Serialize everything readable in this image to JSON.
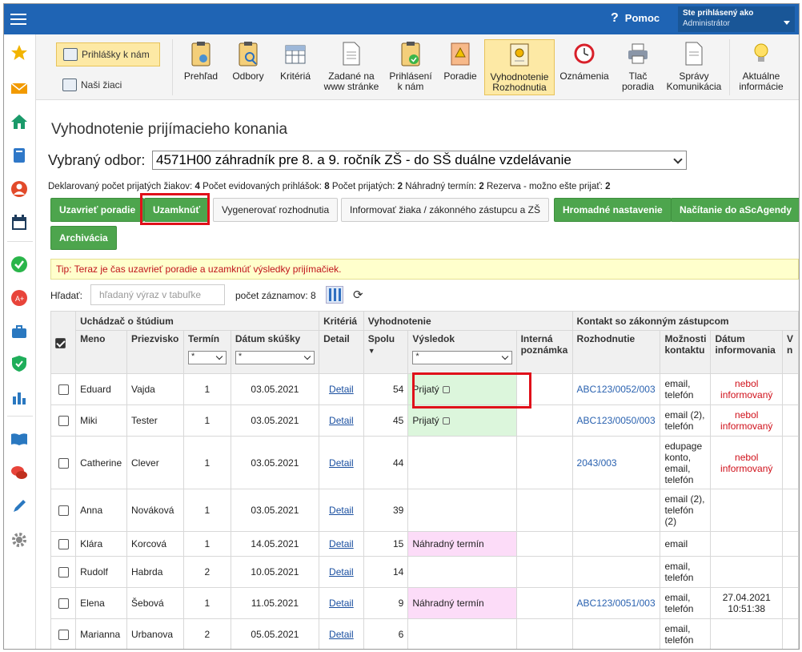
{
  "header": {
    "help_label": "Pomoc",
    "help_icon": "?",
    "user_line1": "Ste prihlásený ako",
    "user_line2": "Administrátor"
  },
  "toolbar": {
    "left_buttons": [
      "Prihlášky k nám",
      "Naši žiaci"
    ],
    "tools": [
      {
        "label1": "Prehľad",
        "label2": ""
      },
      {
        "label1": "Odbory",
        "label2": ""
      },
      {
        "label1": "Kritériá",
        "label2": ""
      },
      {
        "label1": "Zadané na",
        "label2": "www stránke"
      },
      {
        "label1": "Prihlásení",
        "label2": "k nám"
      },
      {
        "label1": "Poradie",
        "label2": ""
      },
      {
        "label1": "Vyhodnotenie",
        "label2": "Rozhodnutia"
      },
      {
        "label1": "Oznámenia",
        "label2": ""
      },
      {
        "label1": "Tlač",
        "label2": "poradia"
      },
      {
        "label1": "Správy",
        "label2": "Komunikácia"
      },
      {
        "label1": "Aktuálne",
        "label2": "informácie"
      }
    ]
  },
  "page": {
    "title": "Vyhodnotenie prijímacieho konania",
    "odbor_label": "Vybraný odbor:",
    "odbor_value": "4571H00 záhradník pre 8. a 9. ročník ZŠ - do SŠ duálne vzdelávanie"
  },
  "stats": {
    "l1": "Deklarovaný počet prijatých žiakov:",
    "v1": "4",
    "l2": "Počet evidovaných prihlášok:",
    "v2": "8",
    "l3": "Počet prijatých:",
    "v3": "2",
    "l4": "Náhradný termín:",
    "v4": "2",
    "l5": "Rezerva - možno ešte prijať:",
    "v5": "2"
  },
  "actions": {
    "close_order": "Uzavrieť poradie",
    "lock": "Uzamknúť",
    "generate": "Vygenerovať rozhodnutia",
    "inform": "Informovať žiaka / zákonného zástupcu a ZŠ",
    "bulk": "Hromadné nastavenie",
    "load": "Načítanie do aScAgendy",
    "archive": "Archivácia"
  },
  "tip": "Tip: Teraz je čas uzavrieť poradie a uzamknúť výsledky prijímačiek.",
  "search": {
    "label": "Hľadať:",
    "placeholder": "hľadaný výraz v tabuľke",
    "count_label": "počet záznamov: 8"
  },
  "table": {
    "groups": {
      "applicant": "Uchádzač o štúdium",
      "criteria": "Kritériá",
      "evaluation": "Vyhodnotenie",
      "contact": "Kontakt so zákonným zástupcom"
    },
    "columns": {
      "name": "Meno",
      "surname": "Priezvisko",
      "term": "Termín",
      "exam_date": "Dátum skúšky",
      "detail": "Detail",
      "total": "Spolu",
      "result": "Výsledok",
      "note1": "Interná",
      "note2": "poznámka",
      "decision": "Rozhodnutie",
      "contact_opts1": "Možnosti",
      "contact_opts2": "kontaktu",
      "inform_date1": "Dátum",
      "inform_date2": "informovania",
      "extra1": "V",
      "extra2": "n"
    },
    "filter_value": "*",
    "detail_link": "Detail",
    "rows": [
      {
        "meno": "Eduard",
        "priezvisko": "Vajda",
        "termin": "1",
        "datum": "03.05.2021",
        "spolu": "54",
        "vysledok": "Prijatý",
        "typ": "prij",
        "rozhodnutie": "ABC123/0052/003",
        "kontakt": [
          "email,",
          "telefón"
        ],
        "inf": [
          "nebol",
          "informovaný"
        ],
        "infred": true
      },
      {
        "meno": "Miki",
        "priezvisko": "Tester",
        "termin": "1",
        "datum": "03.05.2021",
        "spolu": "45",
        "vysledok": "Prijatý",
        "typ": "prij",
        "rozhodnutie": "ABC123/0050/003",
        "kontakt": [
          "email (2),",
          "telefón"
        ],
        "inf": [
          "nebol",
          "informovaný"
        ],
        "infred": true
      },
      {
        "meno": "Catherine",
        "priezvisko": "Clever",
        "termin": "1",
        "datum": "03.05.2021",
        "spolu": "44",
        "vysledok": "",
        "typ": "",
        "rozhodnutie": "2043/003",
        "kontakt": [
          "edupage",
          "konto,",
          "email,",
          "telefón"
        ],
        "inf": [
          "nebol",
          "informovaný"
        ],
        "infred": true
      },
      {
        "meno": "Anna",
        "priezvisko": "Nováková",
        "termin": "1",
        "datum": "03.05.2021",
        "spolu": "39",
        "vysledok": "",
        "typ": "",
        "rozhodnutie": "",
        "kontakt": [
          "email (2),",
          "telefón",
          "(2)"
        ],
        "inf": [],
        "infred": false
      },
      {
        "meno": "Klára",
        "priezvisko": "Korcová",
        "termin": "1",
        "datum": "14.05.2021",
        "spolu": "15",
        "vysledok": "Náhradný termín",
        "typ": "nahr",
        "rozhodnutie": "",
        "kontakt": [
          "email"
        ],
        "inf": [],
        "infred": false
      },
      {
        "meno": "Rudolf",
        "priezvisko": "Habrda",
        "termin": "2",
        "datum": "10.05.2021",
        "spolu": "14",
        "vysledok": "",
        "typ": "",
        "rozhodnutie": "",
        "kontakt": [
          "email,",
          "telefón"
        ],
        "inf": [],
        "infred": false
      },
      {
        "meno": "Elena",
        "priezvisko": "Šebová",
        "termin": "1",
        "datum": "11.05.2021",
        "spolu": "9",
        "vysledok": "Náhradný termín",
        "typ": "nahr",
        "rozhodnutie": "ABC123/0051/003",
        "kontakt": [
          "email,",
          "telefón"
        ],
        "inf": [
          "27.04.2021",
          "10:51:38"
        ],
        "infred": false
      },
      {
        "meno": "Marianna",
        "priezvisko": "Urbanova",
        "termin": "2",
        "datum": "05.05.2021",
        "spolu": "6",
        "vysledok": "",
        "typ": "",
        "rozhodnutie": "",
        "kontakt": [
          "email,",
          "telefón"
        ],
        "inf": [],
        "infred": false
      }
    ]
  },
  "colors": {
    "topbar": "#1f64b4",
    "green_button": "#4da54d",
    "accepted_bg": "#dcf6dc",
    "substitute_bg": "#fcdcf8",
    "highlight_red": "#e0101a"
  }
}
